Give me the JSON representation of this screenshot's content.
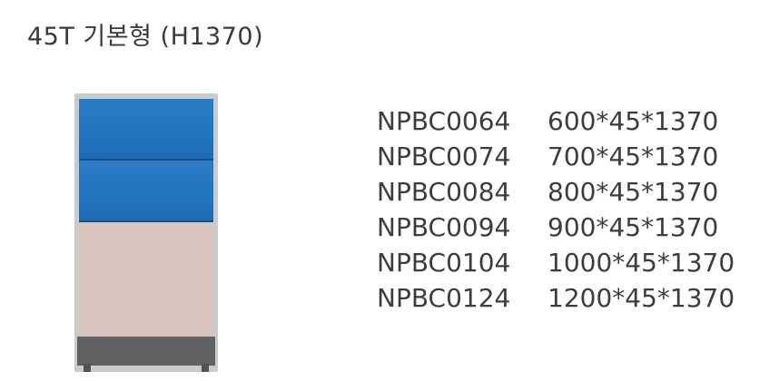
{
  "title": "45T 기본형 (H1370)",
  "products": [
    {
      "code": "NPBC0064",
      "size": "600*45*1370"
    },
    {
      "code": "NPBC0074",
      "size": "700*45*1370"
    },
    {
      "code": "NPBC0084",
      "size": "800*45*1370"
    },
    {
      "code": "NPBC0094",
      "size": "900*45*1370"
    },
    {
      "code": "NPBC0104",
      "size": "1000*45*1370"
    },
    {
      "code": "NPBC0124",
      "size": "1200*45*1370"
    }
  ],
  "colors": {
    "panel_top": "#1c6db5",
    "panel_fabric": "#d8c3bd",
    "panel_base": "#5f6163",
    "text": "#3d3d3d"
  }
}
